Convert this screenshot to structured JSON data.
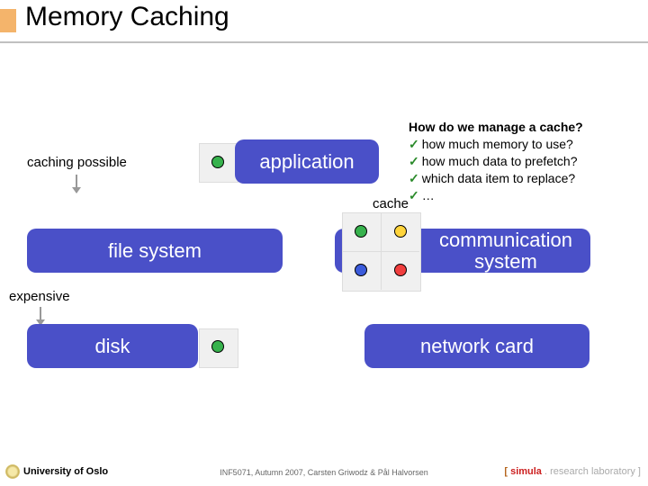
{
  "title": "Memory Caching",
  "labels": {
    "caching_possible": "caching possible",
    "expensive": "expensive",
    "cache": "cache"
  },
  "boxes": {
    "application": "application",
    "file_system": "file system",
    "communication": "communication system",
    "disk": "disk",
    "network_card": "network card"
  },
  "howto": {
    "header": "How do we manage a cache?",
    "items": [
      "how much memory to use?",
      "how much data to prefetch?",
      "which data item to replace?",
      "…"
    ]
  },
  "footer": {
    "university": "University of Oslo",
    "course": "INF5071, Autumn 2007, Carsten Griwodz & Pål Halvorsen",
    "simula_prefix": "[ ",
    "simula_name": "simula",
    "simula_suffix": " . research laboratory ]"
  },
  "colors": {
    "dots": [
      "#37B24D",
      "#FFD43B",
      "#3B5BDB",
      "#37B24D",
      "#F03E3E",
      "#37B24D",
      "#37B24D"
    ]
  }
}
